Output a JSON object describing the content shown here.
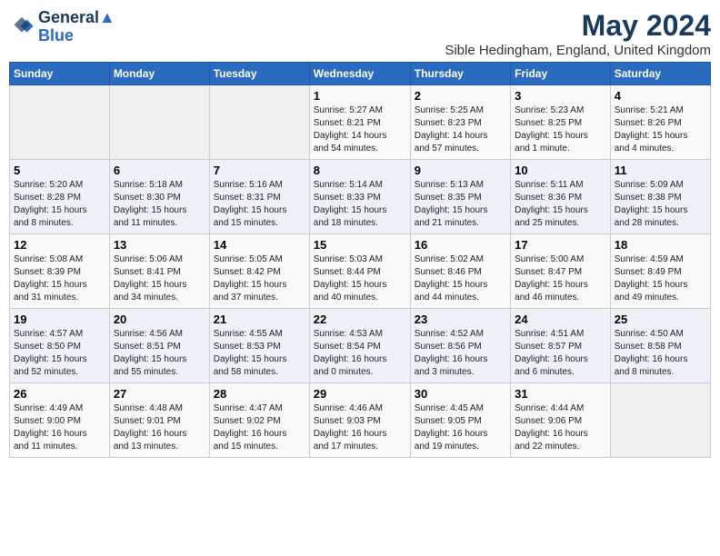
{
  "logo": {
    "line1": "General",
    "line2": "Blue"
  },
  "title": "May 2024",
  "location": "Sible Hedingham, England, United Kingdom",
  "days_of_week": [
    "Sunday",
    "Monday",
    "Tuesday",
    "Wednesday",
    "Thursday",
    "Friday",
    "Saturday"
  ],
  "weeks": [
    [
      {
        "day": "",
        "info": ""
      },
      {
        "day": "",
        "info": ""
      },
      {
        "day": "",
        "info": ""
      },
      {
        "day": "1",
        "info": "Sunrise: 5:27 AM\nSunset: 8:21 PM\nDaylight: 14 hours\nand 54 minutes."
      },
      {
        "day": "2",
        "info": "Sunrise: 5:25 AM\nSunset: 8:23 PM\nDaylight: 14 hours\nand 57 minutes."
      },
      {
        "day": "3",
        "info": "Sunrise: 5:23 AM\nSunset: 8:25 PM\nDaylight: 15 hours\nand 1 minute."
      },
      {
        "day": "4",
        "info": "Sunrise: 5:21 AM\nSunset: 8:26 PM\nDaylight: 15 hours\nand 4 minutes."
      }
    ],
    [
      {
        "day": "5",
        "info": "Sunrise: 5:20 AM\nSunset: 8:28 PM\nDaylight: 15 hours\nand 8 minutes."
      },
      {
        "day": "6",
        "info": "Sunrise: 5:18 AM\nSunset: 8:30 PM\nDaylight: 15 hours\nand 11 minutes."
      },
      {
        "day": "7",
        "info": "Sunrise: 5:16 AM\nSunset: 8:31 PM\nDaylight: 15 hours\nand 15 minutes."
      },
      {
        "day": "8",
        "info": "Sunrise: 5:14 AM\nSunset: 8:33 PM\nDaylight: 15 hours\nand 18 minutes."
      },
      {
        "day": "9",
        "info": "Sunrise: 5:13 AM\nSunset: 8:35 PM\nDaylight: 15 hours\nand 21 minutes."
      },
      {
        "day": "10",
        "info": "Sunrise: 5:11 AM\nSunset: 8:36 PM\nDaylight: 15 hours\nand 25 minutes."
      },
      {
        "day": "11",
        "info": "Sunrise: 5:09 AM\nSunset: 8:38 PM\nDaylight: 15 hours\nand 28 minutes."
      }
    ],
    [
      {
        "day": "12",
        "info": "Sunrise: 5:08 AM\nSunset: 8:39 PM\nDaylight: 15 hours\nand 31 minutes."
      },
      {
        "day": "13",
        "info": "Sunrise: 5:06 AM\nSunset: 8:41 PM\nDaylight: 15 hours\nand 34 minutes."
      },
      {
        "day": "14",
        "info": "Sunrise: 5:05 AM\nSunset: 8:42 PM\nDaylight: 15 hours\nand 37 minutes."
      },
      {
        "day": "15",
        "info": "Sunrise: 5:03 AM\nSunset: 8:44 PM\nDaylight: 15 hours\nand 40 minutes."
      },
      {
        "day": "16",
        "info": "Sunrise: 5:02 AM\nSunset: 8:46 PM\nDaylight: 15 hours\nand 44 minutes."
      },
      {
        "day": "17",
        "info": "Sunrise: 5:00 AM\nSunset: 8:47 PM\nDaylight: 15 hours\nand 46 minutes."
      },
      {
        "day": "18",
        "info": "Sunrise: 4:59 AM\nSunset: 8:49 PM\nDaylight: 15 hours\nand 49 minutes."
      }
    ],
    [
      {
        "day": "19",
        "info": "Sunrise: 4:57 AM\nSunset: 8:50 PM\nDaylight: 15 hours\nand 52 minutes."
      },
      {
        "day": "20",
        "info": "Sunrise: 4:56 AM\nSunset: 8:51 PM\nDaylight: 15 hours\nand 55 minutes."
      },
      {
        "day": "21",
        "info": "Sunrise: 4:55 AM\nSunset: 8:53 PM\nDaylight: 15 hours\nand 58 minutes."
      },
      {
        "day": "22",
        "info": "Sunrise: 4:53 AM\nSunset: 8:54 PM\nDaylight: 16 hours\nand 0 minutes."
      },
      {
        "day": "23",
        "info": "Sunrise: 4:52 AM\nSunset: 8:56 PM\nDaylight: 16 hours\nand 3 minutes."
      },
      {
        "day": "24",
        "info": "Sunrise: 4:51 AM\nSunset: 8:57 PM\nDaylight: 16 hours\nand 6 minutes."
      },
      {
        "day": "25",
        "info": "Sunrise: 4:50 AM\nSunset: 8:58 PM\nDaylight: 16 hours\nand 8 minutes."
      }
    ],
    [
      {
        "day": "26",
        "info": "Sunrise: 4:49 AM\nSunset: 9:00 PM\nDaylight: 16 hours\nand 11 minutes."
      },
      {
        "day": "27",
        "info": "Sunrise: 4:48 AM\nSunset: 9:01 PM\nDaylight: 16 hours\nand 13 minutes."
      },
      {
        "day": "28",
        "info": "Sunrise: 4:47 AM\nSunset: 9:02 PM\nDaylight: 16 hours\nand 15 minutes."
      },
      {
        "day": "29",
        "info": "Sunrise: 4:46 AM\nSunset: 9:03 PM\nDaylight: 16 hours\nand 17 minutes."
      },
      {
        "day": "30",
        "info": "Sunrise: 4:45 AM\nSunset: 9:05 PM\nDaylight: 16 hours\nand 19 minutes."
      },
      {
        "day": "31",
        "info": "Sunrise: 4:44 AM\nSunset: 9:06 PM\nDaylight: 16 hours\nand 22 minutes."
      },
      {
        "day": "",
        "info": ""
      }
    ]
  ]
}
